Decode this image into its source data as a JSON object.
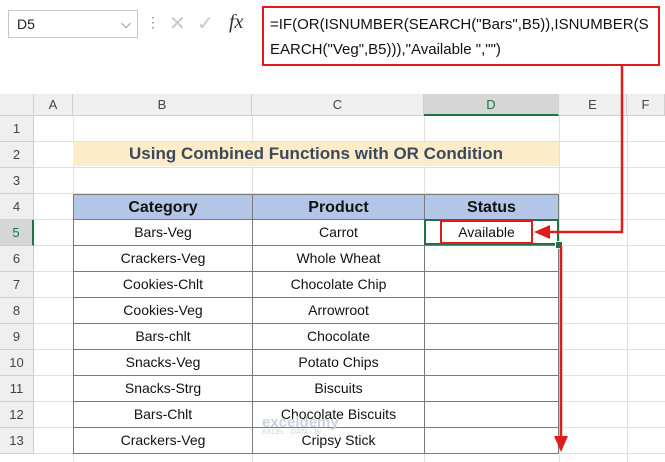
{
  "name_box": "D5",
  "formula": "=IF(OR(ISNUMBER(SEARCH(\"Bars\",B5)),ISNUMBER(SEARCH(\"Veg\",B5))),\"Available \",\"\")",
  "fx_label": "fx",
  "columns": [
    "A",
    "B",
    "C",
    "D",
    "E",
    "F"
  ],
  "rows": [
    "1",
    "2",
    "3",
    "4",
    "5",
    "6",
    "7",
    "8",
    "9",
    "10",
    "11",
    "12",
    "13"
  ],
  "title": "Using Combined Functions with OR Condition",
  "table": {
    "headers": [
      "Category",
      "Product",
      "Status"
    ],
    "rows": [
      [
        "Bars-Veg",
        "Carrot",
        "Available"
      ],
      [
        "Crackers-Veg",
        "Whole Wheat",
        ""
      ],
      [
        "Cookies-Chlt",
        "Chocolate Chip",
        ""
      ],
      [
        "Cookies-Veg",
        "Arrowroot",
        ""
      ],
      [
        "Bars-chlt",
        "Chocolate",
        ""
      ],
      [
        "Snacks-Veg",
        "Potato Chips",
        ""
      ],
      [
        "Snacks-Strg",
        "Biscuits",
        ""
      ],
      [
        "Bars-Chlt",
        "Chocolate Biscuits",
        ""
      ],
      [
        "Crackers-Veg",
        "Cripsy Stick",
        ""
      ]
    ]
  },
  "watermark": "exceldemy",
  "watermark_sub": "EXCEL · DATA · BI",
  "colors": {
    "accent": "#217346",
    "highlight": "#e01b1b",
    "header_fill": "#b4c6e7",
    "title_fill": "#fdecc8"
  }
}
